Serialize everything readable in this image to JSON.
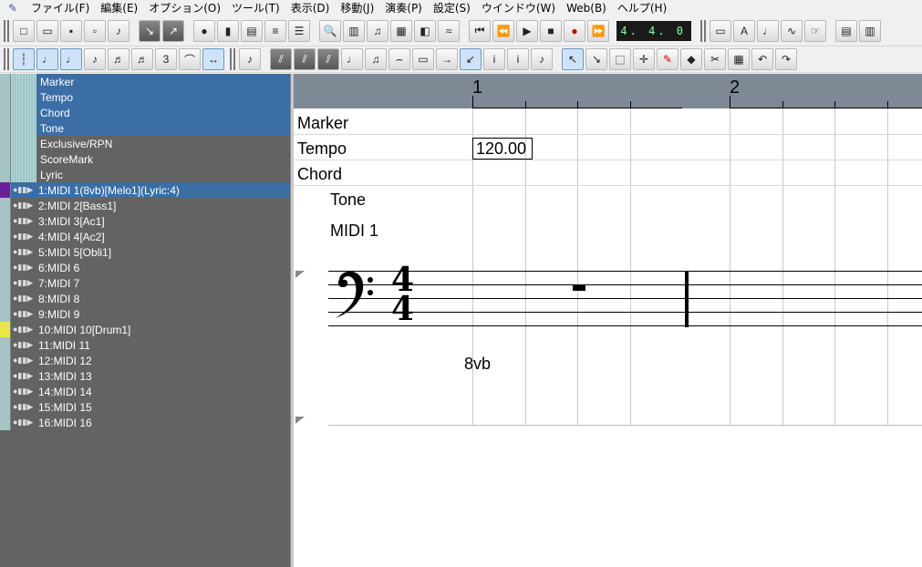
{
  "menu": {
    "items": [
      "ファイル(F)",
      "編集(E)",
      "オプション(O)",
      "ツール(T)",
      "表示(D)",
      "移動(J)",
      "演奏(P)",
      "設定(S)",
      "ウインドウ(W)",
      "Web(B)",
      "ヘルプ(H)"
    ]
  },
  "transport": {
    "counter": "4. 4.  0"
  },
  "tracks": {
    "conductor": [
      "Marker",
      "Tempo",
      "Chord",
      "Tone",
      "Exclusive/RPN",
      "ScoreMark",
      "Lyric"
    ],
    "midi": [
      "1:MIDI 1(8vb)[Melo1](Lyric:4)",
      "2:MIDI 2[Bass1]",
      "3:MIDI 3[Ac1]",
      "4:MIDI 4[Ac2]",
      "5:MIDI 5[Obli1]",
      "6:MIDI 6",
      "7:MIDI 7",
      "8:MIDI 8",
      "9:MIDI 9",
      "10:MIDI 10[Drum1]",
      "11:MIDI 11",
      "12:MIDI 12",
      "13:MIDI 13",
      "14:MIDI 14",
      "15:MIDI 15",
      "16:MIDI 16"
    ]
  },
  "score": {
    "measures": [
      "1",
      "2"
    ],
    "row_labels": [
      "Marker",
      "Tempo",
      "Chord"
    ],
    "tempo_value": "120.00",
    "tone_label": "Tone",
    "track_label": "MIDI 1",
    "octave_text": "8vb",
    "time_signature_top": "4",
    "time_signature_bottom": "4"
  },
  "colors": {
    "selection": "#3a6ea5",
    "panel": "#636363",
    "ruler": "#7f8996",
    "track1_color": "#6b1e9a",
    "track10_color": "#e9e54a"
  }
}
